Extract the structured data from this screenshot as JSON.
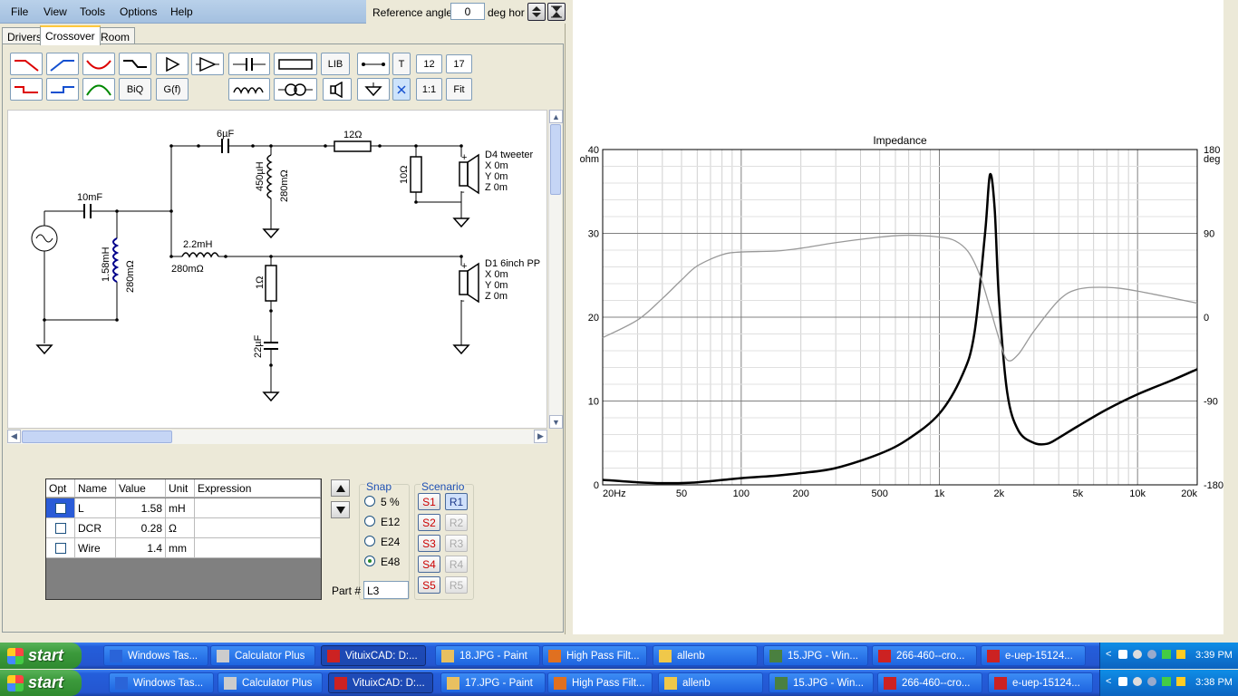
{
  "menu": {
    "items": [
      "File",
      "View",
      "Tools",
      "Options",
      "Help"
    ]
  },
  "reference": {
    "label": "Reference angle",
    "value": "0",
    "unit": "deg hor"
  },
  "tabs": [
    "Drivers",
    "Crossover",
    "Room"
  ],
  "toolbar": {
    "lib": "LIB",
    "t": "T",
    "biq": "BiQ",
    "gf": "G(f)",
    "one": "1:1",
    "fit": "Fit",
    "grid_x": "12",
    "grid_y": "17"
  },
  "schematic": {
    "labels": {
      "c1": "10mF",
      "l1": "1.58mH",
      "l1r": "280mΩ",
      "c2": "6µF",
      "l2": "450µH",
      "l2r": "280mΩ",
      "r1": "12Ω",
      "r2": "10Ω",
      "l3": "2.2mH",
      "l3r": "280mΩ",
      "r3": "1Ω",
      "c3": "22µF"
    },
    "drivers": [
      {
        "name": "D4 tweeter",
        "x": "X 0m",
        "y": "Y 0m",
        "z": "Z 0m"
      },
      {
        "name": "D1 6inch PP",
        "x": "X 0m",
        "y": "Y 0m",
        "z": "Z 0m"
      }
    ]
  },
  "table": {
    "headers": [
      "Opt",
      "Name",
      "Value",
      "Unit",
      "Expression"
    ],
    "rows": [
      {
        "name": "L",
        "value": "1.58",
        "unit": "mH"
      },
      {
        "name": "DCR",
        "value": "0.28",
        "unit": "Ω"
      },
      {
        "name": "Wire",
        "value": "1.4",
        "unit": "mm"
      }
    ]
  },
  "snap": {
    "label": "Snap",
    "options": [
      "5 %",
      "E12",
      "E24",
      "E48"
    ],
    "selected": "E48"
  },
  "scenario": {
    "label": "Scenario",
    "s": [
      "S1",
      "S2",
      "S3",
      "S4",
      "S5"
    ],
    "r": [
      "R1",
      "R2",
      "R3",
      "R4",
      "R5"
    ]
  },
  "part": {
    "label": "Part #",
    "value": "L3"
  },
  "chart_data": {
    "type": "line",
    "title": "Impedance",
    "yunit_left": "ohm",
    "yunit_right": "deg",
    "x_ticks": [
      "20Hz",
      "50",
      "100",
      "200",
      "500",
      "1k",
      "2k",
      "5k",
      "10k",
      "20k"
    ],
    "y_ticks_left": [
      "40",
      "30",
      "20",
      "10",
      "0"
    ],
    "y_ticks_right": [
      "180",
      "90",
      "0",
      "-90",
      "-180"
    ],
    "xlim": [
      20,
      20000
    ],
    "ylim": [
      0,
      40
    ],
    "ylim_right": [
      -180,
      180
    ],
    "x_log": true,
    "grid": true,
    "series": [
      {
        "color": "#000000",
        "x": [
          20,
          30,
          40,
          60,
          100,
          150,
          200,
          300,
          500,
          700,
          1000,
          1300,
          1500,
          1700,
          1800,
          1900,
          2000,
          2200,
          2500,
          3000,
          3500,
          4000,
          5000,
          7000,
          10000,
          15000,
          20000
        ],
        "y": [
          0.6,
          0.3,
          0.2,
          0.3,
          0.8,
          1.1,
          1.4,
          2,
          3.7,
          5.5,
          8.5,
          13,
          18,
          30,
          37,
          33,
          22,
          11,
          6.5,
          5,
          4.9,
          5.6,
          7,
          9,
          10.8,
          12.5,
          13.8
        ]
      },
      {
        "color": "#999999",
        "x": [
          20,
          30,
          40,
          50,
          60,
          80,
          100,
          150,
          200,
          300,
          500,
          700,
          1000,
          1200,
          1400,
          1600,
          1800,
          2000,
          2200,
          2500,
          3000,
          4000,
          5000,
          7000,
          10000,
          20000
        ],
        "y": [
          -22,
          -3,
          20,
          40,
          55,
          67,
          70,
          71,
          74,
          80,
          86,
          88,
          86,
          82,
          70,
          45,
          10,
          -23,
          -46,
          -40,
          -15,
          18,
          30,
          32,
          28,
          15
        ]
      }
    ]
  },
  "taskbar": {
    "start": "start",
    "row1": {
      "items": [
        "Windows Tas...",
        "Calculator Plus",
        "VituixCAD: D:...",
        "18.JPG - Paint",
        "High Pass Filt...",
        "allenb",
        "15.JPG - Win...",
        "266-460--cro...",
        "e-uep-15124..."
      ],
      "clock": "3:39 PM"
    },
    "row2": {
      "items": [
        "Windows Tas...",
        "Calculator Plus",
        "VituixCAD: D:...",
        "17.JPG - Paint",
        "High Pass Filt...",
        "allenb",
        "15.JPG - Win...",
        "266-460--cro...",
        "e-uep-15124..."
      ],
      "clock": "3:38 PM"
    }
  }
}
